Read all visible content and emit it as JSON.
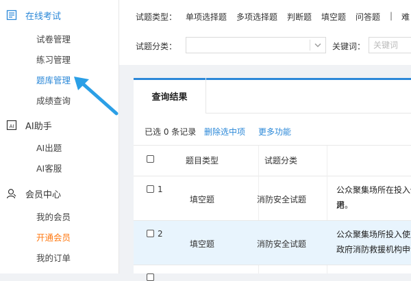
{
  "sidebar": {
    "sections": [
      {
        "label": "在线考试",
        "icon": "document-list-icon",
        "items": [
          "试卷管理",
          "练习管理",
          "题库管理",
          "成绩查询"
        ]
      },
      {
        "label": "AI助手",
        "icon": "ai-assistant-icon",
        "items": [
          "AI出题",
          "AI客服"
        ]
      },
      {
        "label": "会员中心",
        "icon": "member-user-icon",
        "items": [
          "我的会员",
          "开通会员",
          "我的订单"
        ]
      }
    ],
    "active_item": "题库管理",
    "highlight_item": "开通会员"
  },
  "filters": {
    "type_label": "试题类型：",
    "types": [
      "单项选择题",
      "多项选择题",
      "判断题",
      "填空题",
      "问答题"
    ],
    "divider": "|",
    "difficulty_label": "难",
    "category_label": "试题分类：",
    "category_value": "",
    "keyword_label": "关键词：",
    "keyword_placeholder": "关键词"
  },
  "results": {
    "tab_label": "查询结果",
    "selected_text": "已选 0 条记录",
    "delete_label": "删除选中项",
    "more_label": "更多功能",
    "columns": [
      "题目类型",
      "试题分类"
    ],
    "rows": [
      {
        "num": "1",
        "type": "填空题",
        "category": "消防安全试题",
        "line1": "公众聚集场所在投入使用",
        "line2": "诺。"
      },
      {
        "num": "2",
        "type": "填空题",
        "category": "消防安全试题",
        "line1": "公众聚集场所投入使用",
        "line2": "政府消防救援机构申请"
      }
    ]
  },
  "colors": {
    "accent": "#2b88d8",
    "highlight": "#ff7a14",
    "selected_row": "#e8f4fd"
  }
}
